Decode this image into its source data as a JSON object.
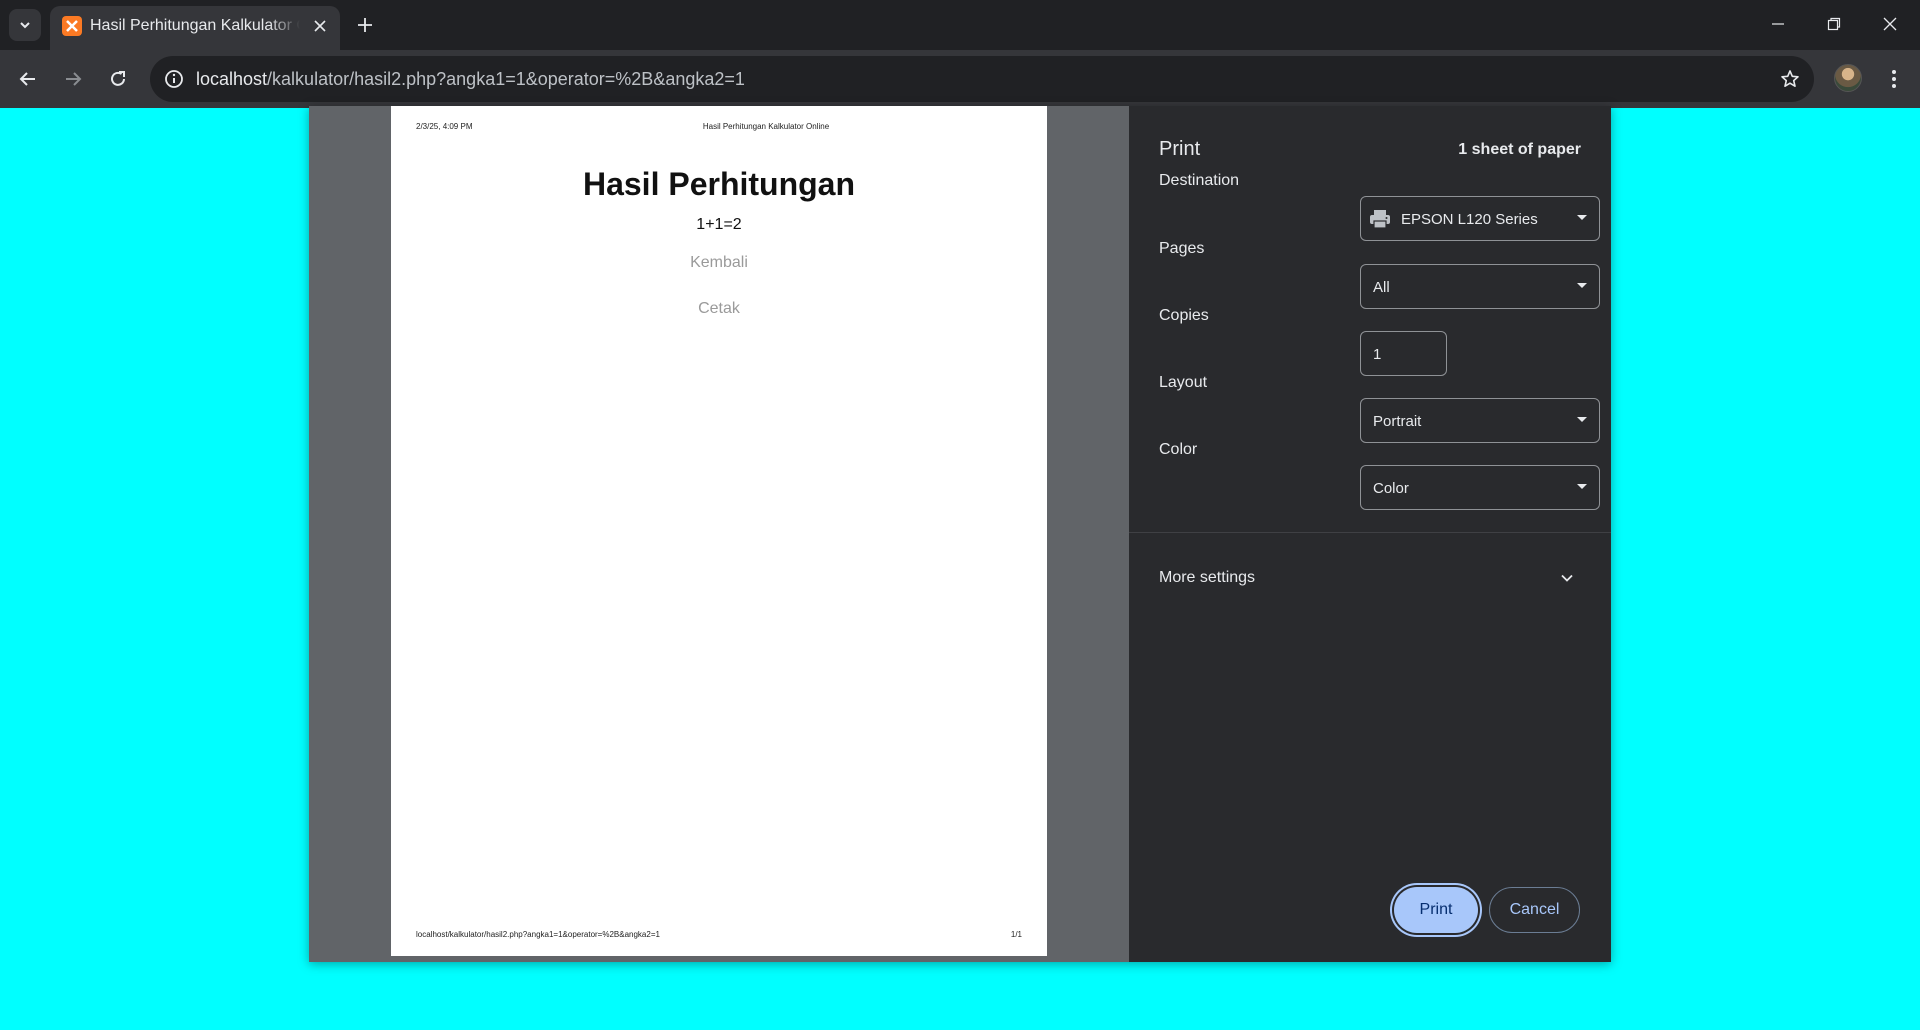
{
  "browser": {
    "tab_title": "Hasil Perhitungan Kalkulator Online",
    "url_host": "localhost",
    "url_path": "/kalkulator/hasil2.php?angka1=1&operator=%2B&angka2=1"
  },
  "preview": {
    "header_left": "2/3/25, 4:09 PM",
    "header_center": "Hasil Perhitungan Kalkulator Online",
    "heading": "Hasil Perhitungan",
    "result": "1+1=2",
    "link_back": "Kembali",
    "link_print": "Cetak",
    "footer_left": "localhost/kalkulator/hasil2.php?angka1=1&operator=%2B&angka2=1",
    "footer_right": "1/1"
  },
  "print_panel": {
    "title": "Print",
    "sheets": "1 sheet of paper",
    "destination_label": "Destination",
    "destination_value": "EPSON L120 Series",
    "pages_label": "Pages",
    "pages_value": "All",
    "copies_label": "Copies",
    "copies_value": "1",
    "layout_label": "Layout",
    "layout_value": "Portrait",
    "color_label": "Color",
    "color_value": "Color",
    "more_settings": "More settings",
    "print_button": "Print",
    "cancel_button": "Cancel"
  },
  "colors": {
    "page_background": "#00ffff",
    "dialog_sidebar": "#292a2d",
    "primary_button": "#a8c7fa"
  }
}
